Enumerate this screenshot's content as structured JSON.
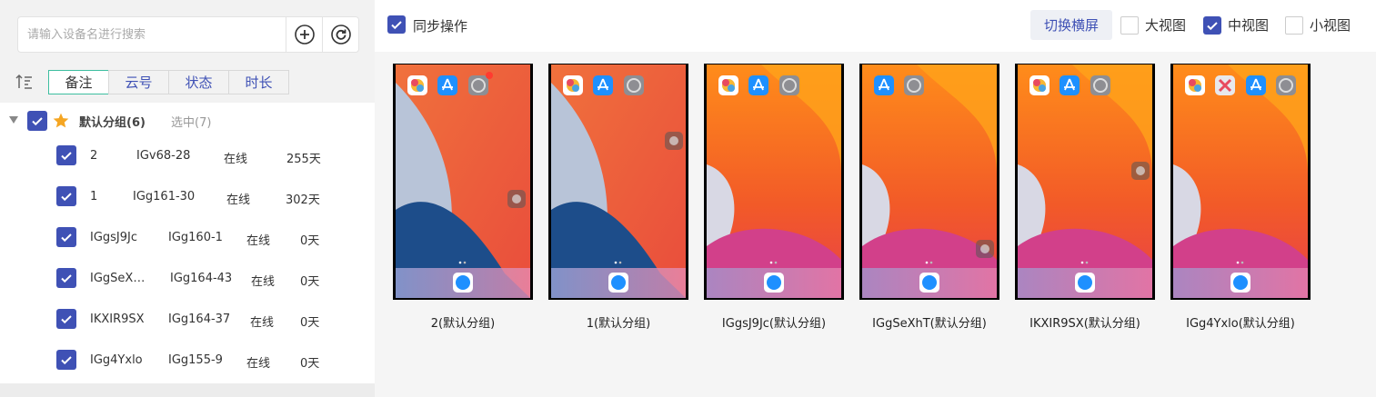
{
  "search": {
    "placeholder": "请输入设备名进行搜索"
  },
  "tabs": [
    {
      "label": "备注",
      "active": true
    },
    {
      "label": "云号",
      "active": false
    },
    {
      "label": "状态",
      "active": false
    },
    {
      "label": "时长",
      "active": false
    }
  ],
  "group": {
    "name": "默认分组(6)",
    "selected": "选中(7)"
  },
  "devices": [
    {
      "note": "2",
      "cloud_id": "IGv68-28",
      "status": "在线",
      "duration": "255天"
    },
    {
      "note": "1",
      "cloud_id": "IGg161-30",
      "status": "在线",
      "duration": "302天"
    },
    {
      "note": "IGgsJ9Jc",
      "cloud_id": "IGg160-1",
      "status": "在线",
      "duration": "0天"
    },
    {
      "note": "IGgSeX…",
      "cloud_id": "IGg164-43",
      "status": "在线",
      "duration": "0天"
    },
    {
      "note": "IKXIR9SX",
      "cloud_id": "IGg164-37",
      "status": "在线",
      "duration": "0天"
    },
    {
      "note": "IGg4Yxlo",
      "cloud_id": "IGg155-9",
      "status": "在线",
      "duration": "0天"
    }
  ],
  "toolbar": {
    "sync_label": "同步操作",
    "switch_label": "切换横屏",
    "views": [
      {
        "label": "大视图",
        "checked": false
      },
      {
        "label": "中视图",
        "checked": true
      },
      {
        "label": "小视图",
        "checked": false
      }
    ]
  },
  "screens": [
    {
      "caption": "2(默认分组)",
      "wallpaper": "orange-blue"
    },
    {
      "caption": "1(默认分组)",
      "wallpaper": "orange-blue"
    },
    {
      "caption": "IGgsJ9Jc(默认分组)",
      "wallpaper": "orange-pink"
    },
    {
      "caption": "IGgSeXhT(默认分组)",
      "wallpaper": "orange-pink"
    },
    {
      "caption": "IKXIR9SX(默认分组)",
      "wallpaper": "orange-pink"
    },
    {
      "caption": "IGg4Yxlo(默认分组)",
      "wallpaper": "orange-pink"
    }
  ],
  "colors": {
    "accent": "#3f51b5",
    "tab_active_border": "#3dbea0",
    "star": "#f5a623"
  }
}
